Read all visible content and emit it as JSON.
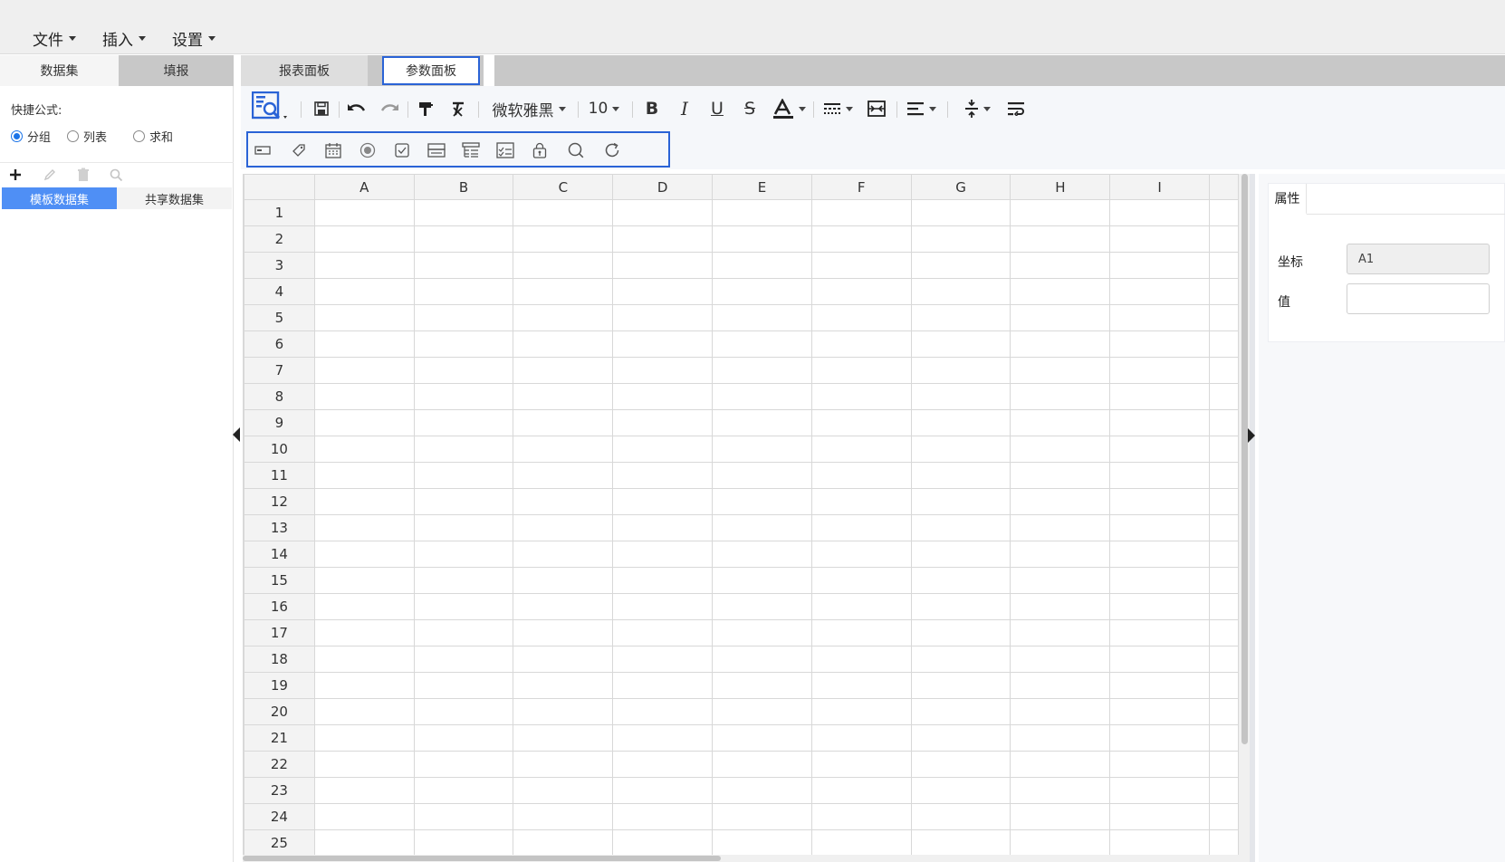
{
  "menu": [
    {
      "label": "文件"
    },
    {
      "label": "插入"
    },
    {
      "label": "设置"
    }
  ],
  "left_panel": {
    "tabs": [
      {
        "label": "数据集",
        "active": true
      },
      {
        "label": "填报",
        "active": false
      }
    ],
    "quick_formula_label": "快捷公式:",
    "radios": [
      {
        "label": "分组",
        "checked": true
      },
      {
        "label": "列表",
        "checked": false
      },
      {
        "label": "求和",
        "checked": false
      }
    ],
    "toolbar_icons": [
      "add-icon",
      "edit-icon",
      "delete-icon",
      "search-icon"
    ],
    "dataset_tabs": [
      {
        "label": "模板数据集",
        "active": true
      },
      {
        "label": "共享数据集",
        "active": false
      }
    ]
  },
  "center_tabs": [
    {
      "label": "报表面板",
      "active": false
    },
    {
      "label": "参数面板",
      "active": true
    }
  ],
  "toolbar": {
    "font_name": "微软雅黑",
    "font_size": "10"
  },
  "param_icons": [
    "text-input-icon",
    "tag-icon",
    "calendar-icon",
    "radio-icon",
    "checkbox-icon",
    "dropdown-icon",
    "tree-select-icon",
    "checklist-icon",
    "lock-icon",
    "query-search-icon",
    "reset-icon"
  ],
  "grid": {
    "columns": [
      "A",
      "B",
      "C",
      "D",
      "E",
      "F",
      "G",
      "H",
      "I"
    ],
    "rows": [
      "1",
      "2",
      "3",
      "4",
      "5",
      "6",
      "7",
      "8",
      "9",
      "10",
      "11",
      "12",
      "13",
      "14",
      "15",
      "16",
      "17",
      "18",
      "19",
      "20",
      "21",
      "22",
      "23",
      "24",
      "25"
    ]
  },
  "properties": {
    "tab_label": "属性",
    "coord_label": "坐标",
    "coord_value": "A1",
    "value_label": "值",
    "value_value": ""
  },
  "colors": {
    "accent": "#2a63d6",
    "tab_active_bg": "#4f8ff5"
  }
}
